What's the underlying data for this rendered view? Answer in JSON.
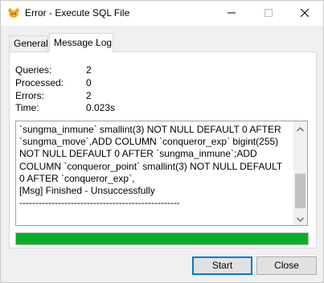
{
  "window": {
    "title": "Error - Execute SQL File"
  },
  "tabs": [
    {
      "label": "General",
      "active": false
    },
    {
      "label": "Message Log",
      "active": true
    }
  ],
  "stats": {
    "queries": {
      "label": "Queries:",
      "value": "2"
    },
    "processed": {
      "label": "Processed:",
      "value": "0"
    },
    "errors": {
      "label": "Errors:",
      "value": "2"
    },
    "time": {
      "label": "Time:",
      "value": "0.023s"
    }
  },
  "log": {
    "text": "`sungma_inmune` smallint(3) NOT NULL DEFAULT 0 AFTER `sungma_move`,ADD COLUMN `conqueror_exp` bigint(255) NOT NULL DEFAULT 0 AFTER `sungma_inmune`;ADD COLUMN `conqueror_point` smallint(3) NOT NULL DEFAULT 0 AFTER `conqueror_exp`,\n[Msg] Finished - Unsuccessfully\n--------------------------------------------------"
  },
  "progress": {
    "fraction": 1.0,
    "color": "#06b025"
  },
  "buttons": {
    "start": "Start",
    "close": "Close"
  },
  "icons": {
    "app": "navicat-app-icon",
    "minimize": "minimize-icon",
    "maximize": "maximize-icon",
    "close": "close-icon",
    "scroll_up": "chevron-up-icon",
    "scroll_down": "chevron-down-icon"
  },
  "colors": {
    "accent": "#0078d7",
    "progress": "#06b025"
  }
}
